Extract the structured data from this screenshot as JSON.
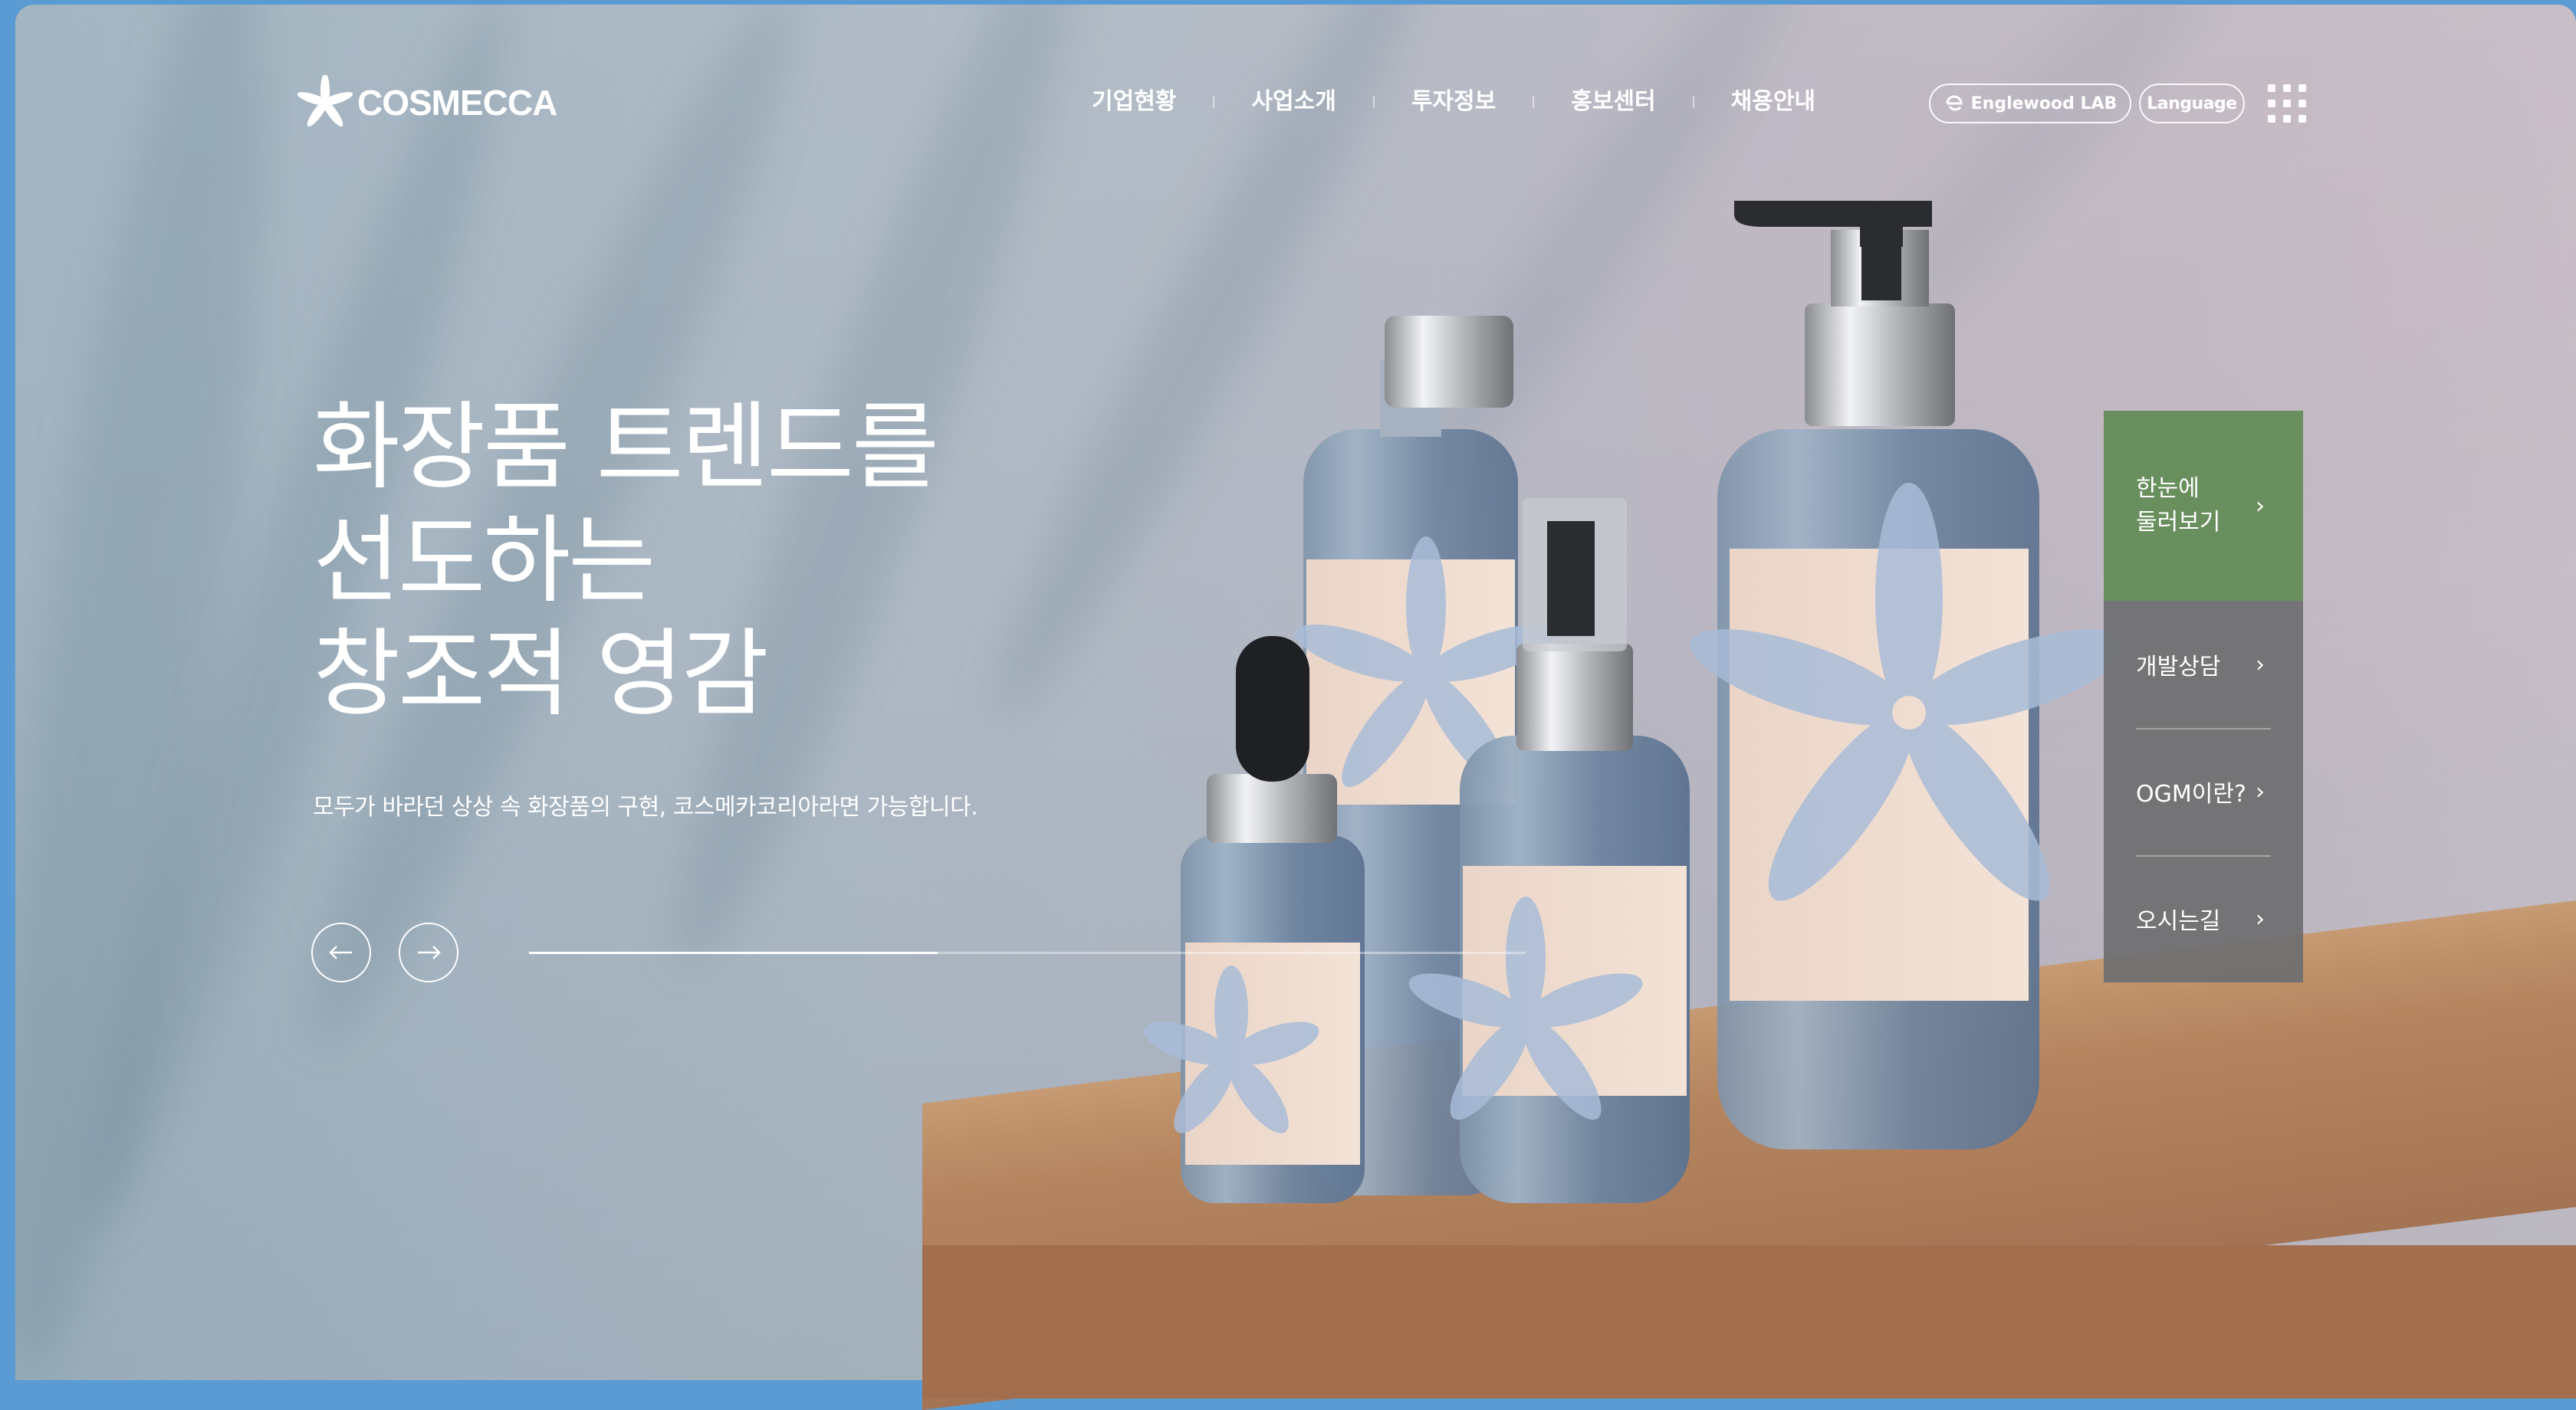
{
  "brand": {
    "name": "COSMECCA"
  },
  "nav": {
    "items": [
      "기업현황",
      "사업소개",
      "투자정보",
      "홍보센터",
      "채용안내"
    ]
  },
  "header": {
    "lab_label": "Englewood LAB",
    "language_label": "Language"
  },
  "hero": {
    "headline": [
      "화장품 트렌드를",
      "선도하는",
      "창조적 영감"
    ],
    "subtext": "모두가 바라던 상상 속 화장품의 구현, 코스메카코리아라면 가능합니다.",
    "slide_progress": 0.41
  },
  "quick_menu": {
    "items": [
      {
        "label": "한눈에\n둘러보기"
      },
      {
        "label": "개발상담"
      },
      {
        "label": "OGM이란?"
      },
      {
        "label": "오시는길"
      }
    ],
    "chevron": "›"
  },
  "colors": {
    "accent_green": "#6a8f5e",
    "quick_gray": "#6e6e70",
    "page_border": "#5b9bd3"
  },
  "icons": {
    "logo": "flower-star-icon",
    "lab": "e-logo-icon",
    "menu": "grid-menu-icon",
    "prev": "arrow-left-icon",
    "next": "arrow-right-icon"
  }
}
